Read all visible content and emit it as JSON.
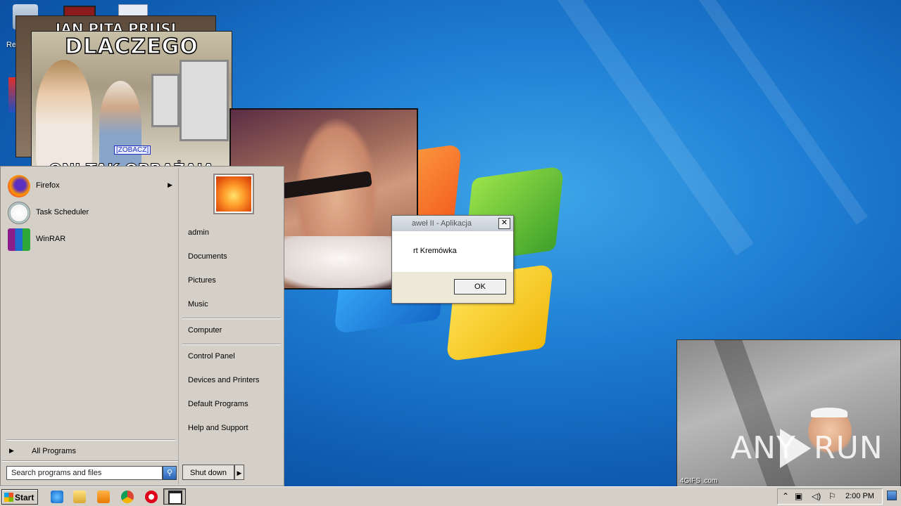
{
  "meme_back": {
    "caption": "JAN PITA PRUSI"
  },
  "meme_front": {
    "caption_top": "DLACZEGO",
    "caption_bottom": "ONI TAK OBRAŻAJĄ",
    "link": "[ZOBACZ]"
  },
  "dialog": {
    "title": "aweł II - Aplikacja",
    "message": "rt Kremówka",
    "ok_label": "OK",
    "close_label": "✕"
  },
  "start_menu": {
    "programs": [
      {
        "label": "Firefox",
        "icon": "firefox-icon",
        "has_submenu": true
      },
      {
        "label": "Task Scheduler",
        "icon": "clock-icon",
        "has_submenu": false
      },
      {
        "label": "WinRAR",
        "icon": "winrar-icon",
        "has_submenu": false
      }
    ],
    "all_programs": "All Programs",
    "search_placeholder": "Search programs and files",
    "right_items": [
      "admin",
      "Documents",
      "Pictures",
      "Music",
      "Computer",
      "Control Panel",
      "Devices and Printers",
      "Default Programs",
      "Help and Support"
    ],
    "shutdown_label": "Shut down"
  },
  "taskbar": {
    "start_label": "Start",
    "clock": "2:00 PM",
    "pinned": [
      "internet-explorer-icon",
      "explorer-icon",
      "media-player-icon",
      "chrome-icon",
      "opera-icon",
      "window-icon"
    ]
  },
  "gif": {
    "caption": "4GIFS .com"
  },
  "watermark": {
    "left": "ANY",
    "right": "RUN"
  },
  "desktop": {
    "icon_label_recycle": "Re"
  },
  "colors": {
    "accent": "#1f7fd4",
    "taskbar": "#d4d0c8"
  }
}
